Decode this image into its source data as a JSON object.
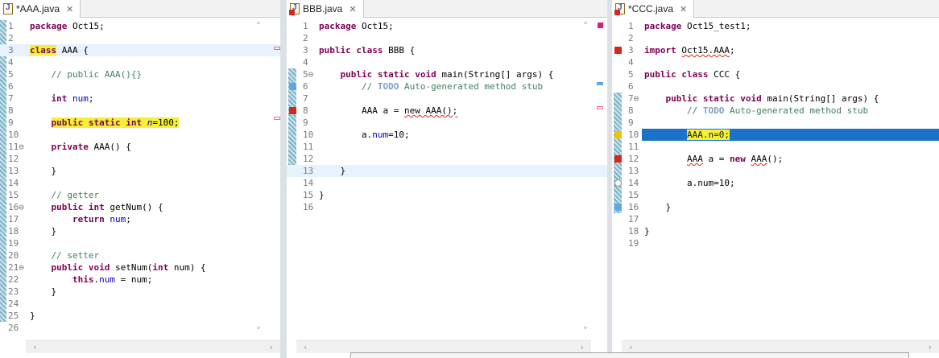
{
  "panes": [
    {
      "tab_label": "*AAA.java",
      "lines": [
        [
          {
            "t": "package",
            "c": "kw"
          },
          {
            "t": " Oct15;"
          }
        ],
        [],
        [
          {
            "t": "class",
            "c": "kw hl-yellow"
          },
          {
            "t": " AAA {"
          }
        ],
        [],
        [
          {
            "t": "    "
          },
          {
            "t": "// public AAA(){}",
            "c": "cm"
          }
        ],
        [],
        [
          {
            "t": "    "
          },
          {
            "t": "int",
            "c": "kw"
          },
          {
            "t": " "
          },
          {
            "t": "num",
            "c": "fld"
          },
          {
            "t": ";"
          }
        ],
        [],
        [
          {
            "t": "    "
          },
          {
            "t": "public static int ",
            "c": "kw hl-yellow"
          },
          {
            "t": "n",
            "c": "fld ital hl-yellow"
          },
          {
            "t": "=100;",
            "c": "hl-yellow"
          }
        ],
        [],
        [
          {
            "t": "    "
          },
          {
            "t": "private",
            "c": "kw"
          },
          {
            "t": " AAA() {"
          }
        ],
        [],
        [
          {
            "t": "    }"
          }
        ],
        [],
        [
          {
            "t": "    "
          },
          {
            "t": "// getter",
            "c": "cm"
          }
        ],
        [
          {
            "t": "    "
          },
          {
            "t": "public int",
            "c": "kw"
          },
          {
            "t": " getNum() {"
          }
        ],
        [
          {
            "t": "        "
          },
          {
            "t": "return",
            "c": "kw"
          },
          {
            "t": " "
          },
          {
            "t": "num",
            "c": "fld"
          },
          {
            "t": ";"
          }
        ],
        [
          {
            "t": "    }"
          }
        ],
        [],
        [
          {
            "t": "    "
          },
          {
            "t": "// setter",
            "c": "cm"
          }
        ],
        [
          {
            "t": "    "
          },
          {
            "t": "public void",
            "c": "kw"
          },
          {
            "t": " setNum("
          },
          {
            "t": "int",
            "c": "kw"
          },
          {
            "t": " num) {"
          }
        ],
        [
          {
            "t": "        "
          },
          {
            "t": "this",
            "c": "kw"
          },
          {
            "t": "."
          },
          {
            "t": "num",
            "c": "fld"
          },
          {
            "t": " = num;"
          }
        ],
        [
          {
            "t": "    }"
          }
        ],
        [],
        [
          {
            "t": "}"
          }
        ],
        []
      ],
      "line_numbers": [
        "1",
        "2",
        "3",
        "4",
        "5",
        "6",
        "7",
        "8",
        "9",
        "10",
        "11⊖",
        "12",
        "13",
        "14",
        "15",
        "16⊖",
        "17",
        "18",
        "19",
        "20",
        "21⊖",
        "22",
        "23",
        "24",
        "25",
        "26"
      ]
    },
    {
      "tab_label": "BBB.java",
      "lines": [
        [
          {
            "t": "package",
            "c": "kw"
          },
          {
            "t": " Oct15;"
          }
        ],
        [],
        [
          {
            "t": "public class",
            "c": "kw"
          },
          {
            "t": " BBB {"
          }
        ],
        [],
        [
          {
            "t": "    "
          },
          {
            "t": "public static void",
            "c": "kw"
          },
          {
            "t": " main(String[] args) {"
          }
        ],
        [
          {
            "t": "        "
          },
          {
            "t": "// ",
            "c": "cm"
          },
          {
            "t": "TODO",
            "c": "td"
          },
          {
            "t": " Auto-generated method stub",
            "c": "cm"
          }
        ],
        [],
        [
          {
            "t": "        AAA a = "
          },
          {
            "t": "new AAA();",
            "c": "squig"
          }
        ],
        [],
        [
          {
            "t": "        a."
          },
          {
            "t": "num",
            "c": "fld"
          },
          {
            "t": "=10;"
          }
        ],
        [],
        [],
        [
          {
            "t": "    }"
          }
        ],
        [],
        [
          {
            "t": "}"
          }
        ],
        []
      ],
      "line_numbers": [
        "1",
        "2",
        "3",
        "4",
        "5⊖",
        "6",
        "7",
        "8",
        "9",
        "10",
        "11",
        "12",
        "13",
        "14",
        "15",
        "16"
      ]
    },
    {
      "tab_label": "*CCC.java",
      "lines": [
        [
          {
            "t": "package",
            "c": "kw"
          },
          {
            "t": " Oct15_test1;"
          }
        ],
        [],
        [
          {
            "t": "import",
            "c": "kw"
          },
          {
            "t": " "
          },
          {
            "t": "Oct15.AAA",
            "c": "squig"
          },
          {
            "t": ";"
          }
        ],
        [],
        [
          {
            "t": "public class",
            "c": "kw"
          },
          {
            "t": " CCC {"
          }
        ],
        [],
        [
          {
            "t": "    "
          },
          {
            "t": "public static void",
            "c": "kw"
          },
          {
            "t": " main(String[] args) {"
          }
        ],
        [
          {
            "t": "        "
          },
          {
            "t": "// ",
            "c": "cm"
          },
          {
            "t": "TODO",
            "c": "td"
          },
          {
            "t": " Auto-generated method stub",
            "c": "cm"
          }
        ],
        [],
        [
          {
            "t": "        "
          },
          {
            "t": "AAA.n=0;",
            "c": "hl-yellow sel-text"
          }
        ],
        [],
        [
          {
            "t": "        "
          },
          {
            "t": "AAA",
            "c": "squig"
          },
          {
            "t": " a = "
          },
          {
            "t": "new",
            "c": "kw"
          },
          {
            "t": " "
          },
          {
            "t": "AAA",
            "c": "squig"
          },
          {
            "t": "();"
          }
        ],
        [],
        [
          {
            "t": "        a.num=10;"
          }
        ],
        [],
        [
          {
            "t": "    }"
          }
        ],
        [],
        [
          {
            "t": "}"
          }
        ],
        []
      ],
      "line_numbers": [
        "1",
        "2",
        "3",
        "4",
        "5",
        "6",
        "7⊖",
        "8",
        "9",
        "10",
        "11",
        "12",
        "13",
        "14",
        "15",
        "16",
        "17",
        "18",
        "19"
      ]
    }
  ],
  "colors": {
    "selection_line": "#1a73c9",
    "current_line": "#e8f2fe",
    "highlight": "#f5f036",
    "error_marker": "#d9261c",
    "warning_marker": "#f2c200",
    "overview_pink": "#f06ba8",
    "overview_blue": "#5fa8e8",
    "gutter_hatch": "#79b3c7"
  },
  "icons": [
    "java-file-icon",
    "close-icon",
    "error-marker-icon",
    "warning-marker-icon",
    "info-marker-icon",
    "scroll-left-icon",
    "scroll-right-icon",
    "scroll-up-icon",
    "scroll-down-icon"
  ]
}
